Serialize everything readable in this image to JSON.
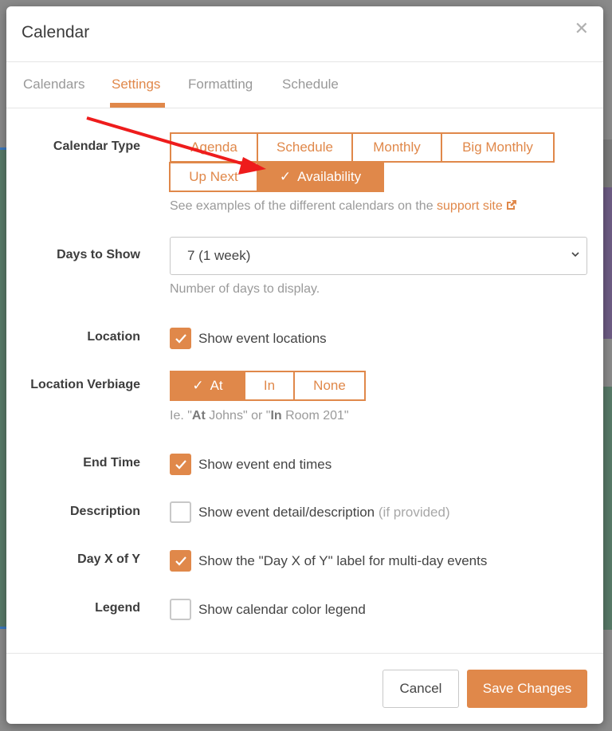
{
  "modal": {
    "title": "Calendar",
    "close_icon": "close-icon"
  },
  "tabs": [
    {
      "label": "Calendars",
      "active": false
    },
    {
      "label": "Settings",
      "active": true
    },
    {
      "label": "Formatting",
      "active": false
    },
    {
      "label": "Schedule",
      "active": false
    }
  ],
  "calendar_type": {
    "label": "Calendar Type",
    "options": [
      {
        "label": "Agenda",
        "selected": false
      },
      {
        "label": "Schedule",
        "selected": false
      },
      {
        "label": "Monthly",
        "selected": false
      },
      {
        "label": "Big Monthly",
        "selected": false
      },
      {
        "label": "Up Next",
        "selected": false
      },
      {
        "label": "Availability",
        "selected": true
      }
    ],
    "help_prefix": "See examples of the different calendars on the ",
    "help_link": "support site",
    "link_icon": "external-link-icon"
  },
  "days_to_show": {
    "label": "Days to Show",
    "value": "7 (1 week)",
    "help": "Number of days to display."
  },
  "location": {
    "label": "Location",
    "checkbox_label": "Show event locations",
    "checked": true
  },
  "location_verbiage": {
    "label": "Location Verbiage",
    "options": [
      {
        "label": "At",
        "selected": true
      },
      {
        "label": "In",
        "selected": false
      },
      {
        "label": "None",
        "selected": false
      }
    ],
    "help": {
      "p1": "Ie. \"",
      "b1": "At",
      "p2": " Johns\" or \"",
      "b2": "In",
      "p3": " Room 201\""
    }
  },
  "end_time": {
    "label": "End Time",
    "checkbox_label": "Show event end times",
    "checked": true
  },
  "description": {
    "label": "Description",
    "checkbox_label": "Show event detail/description",
    "checkbox_suffix": "(if provided)",
    "checked": false
  },
  "day_x_of_y": {
    "label": "Day X of Y",
    "checkbox_label": "Show the \"Day X of Y\" label for multi-day events",
    "checked": true
  },
  "legend": {
    "label": "Legend",
    "checkbox_label": "Show calendar color legend",
    "checked": false
  },
  "footer": {
    "cancel_label": "Cancel",
    "save_label": "Save Changes"
  },
  "colors": {
    "accent": "#e0884a",
    "annotation_arrow": "#ee1c1c"
  }
}
